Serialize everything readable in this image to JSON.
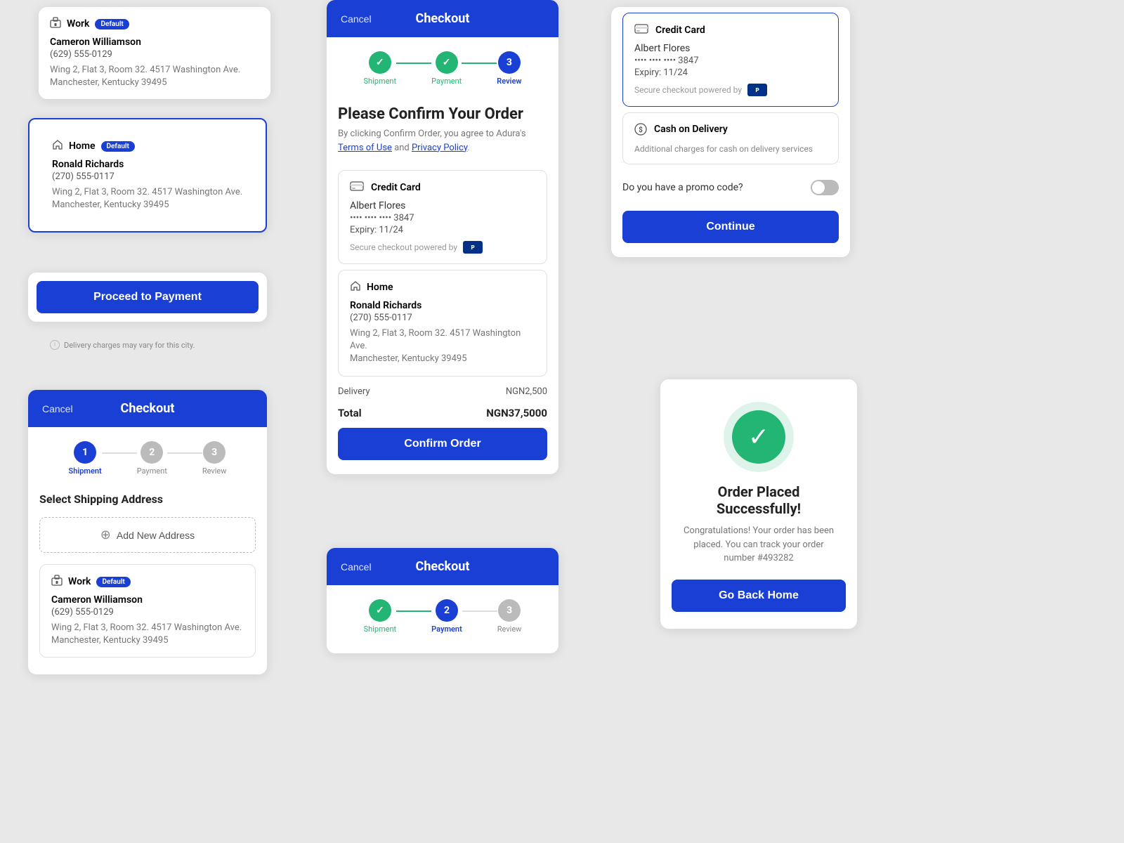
{
  "colors": {
    "primary": "#1a3fd4",
    "success": "#22b573",
    "inactive": "#bbb",
    "danger": "#e53935"
  },
  "topLeftCard": {
    "type": "Work",
    "badge": "Default",
    "name": "Cameron Williamson",
    "phone": "(629) 555-0129",
    "address": "Wing 2, Flat 3, Room 32. 4517 Washington Ave.\nManchester, Kentucky 39495"
  },
  "topLeftCard2": {
    "type": "Home",
    "badge": "Default",
    "name": "Ronald Richards",
    "phone": "(270) 555-0117",
    "address": "Wing 2, Flat 3, Room 32. 4517 Washington Ave.\nManchester, Kentucky 39495"
  },
  "bottomLeftCheckout": {
    "headerCancel": "Cancel",
    "headerTitle": "Checkout",
    "steps": [
      {
        "label": "Shipment",
        "state": "active",
        "number": "1"
      },
      {
        "label": "Payment",
        "state": "inactive",
        "number": "2"
      },
      {
        "label": "Review",
        "state": "inactive",
        "number": "3"
      }
    ],
    "sectionTitle": "Select Shipping Address",
    "addNew": "Add New Address",
    "addresses": [
      {
        "type": "Work",
        "badge": "Default",
        "name": "Cameron Williamson",
        "phone": "(629) 555-0129",
        "address": "Wing 2, Flat 3, Room 32. 4517 Washington Ave.\nManchester, Kentucky 39495",
        "selected": false
      }
    ],
    "proceedBtn": "Proceed to Payment",
    "infoNote": "Delivery charges may vary for this city."
  },
  "topRightPayment": {
    "creditCard": {
      "title": "Credit Card",
      "name": "Albert Flores",
      "number": "•••• •••• •••• 3847",
      "expiry": "Expiry: 11/24",
      "secureText": "Secure checkout powered by"
    },
    "cashOnDelivery": {
      "title": "Cash on Delivery",
      "desc": "Additional charges for cash on delivery services"
    },
    "promoLabel": "Do you have a promo code?",
    "continueBtn": "Continue"
  },
  "middleCheckout": {
    "headerCancel": "Cancel",
    "headerTitle": "Checkout",
    "steps": [
      {
        "label": "Shipment",
        "state": "done"
      },
      {
        "label": "Payment",
        "state": "done"
      },
      {
        "label": "Review",
        "state": "active",
        "number": "3"
      }
    ],
    "confirmTitle": "Please Confirm Your Order",
    "confirmSubtext": "By clicking Confirm Order, you agree to Adura's Terms of Use and Privacy Policy.",
    "creditCard": {
      "title": "Credit Card",
      "name": "Albert Flores",
      "number": "•••• •••• •••• 3847",
      "expiry": "Expiry: 11/24",
      "secureText": "Secure checkout powered by"
    },
    "address": {
      "type": "Home",
      "name": "Ronald Richards",
      "phone": "(270) 555-0117",
      "address": "Wing 2, Flat 3, Room 32. 4517 Washington Ave.\nManchester, Kentucky 39495"
    },
    "delivery": {
      "label": "Delivery",
      "value": "NGN2,500"
    },
    "total": {
      "label": "Total",
      "value": "NGN37,5000"
    },
    "confirmBtn": "Confirm Order"
  },
  "bottomMiddleCheckout": {
    "headerCancel": "Cancel",
    "headerTitle": "Checkout",
    "steps": [
      {
        "label": "Shipment",
        "state": "done"
      },
      {
        "label": "Payment",
        "state": "active",
        "number": "2"
      },
      {
        "label": "Review",
        "state": "inactive",
        "number": "3"
      }
    ]
  },
  "successCard": {
    "title": "Order Placed Successfully!",
    "desc": "Congratulations! Your order has been placed. You can track your order number #493282",
    "goHomeBtn": "Go Back Home"
  }
}
